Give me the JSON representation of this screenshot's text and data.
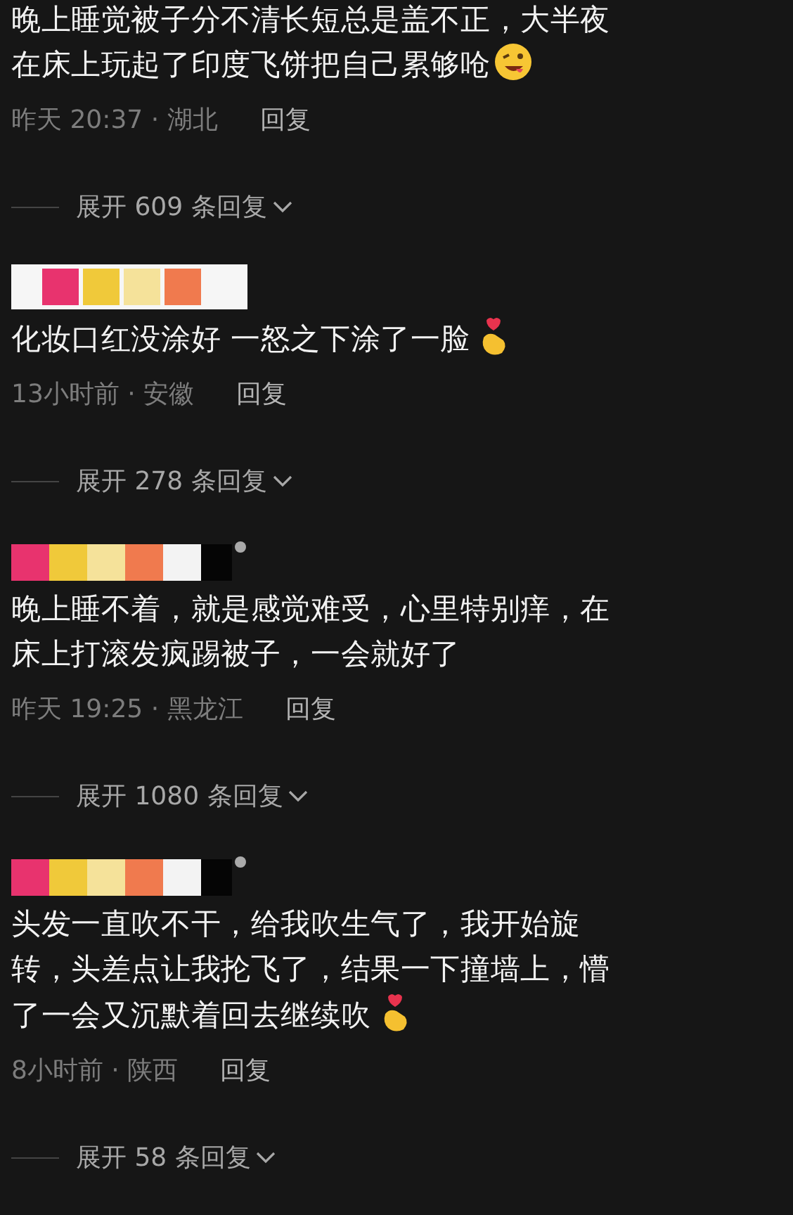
{
  "comments": [
    {
      "lines": [
        "晚上睡觉被子分不清长短总是盖不正，大半夜",
        "在床上玩起了印度飞饼把自己累够呛"
      ],
      "emoji": {
        "kind": "wink"
      },
      "meta": "昨天 20:37 · 湖北",
      "reply": "回复",
      "expand": "展开 609 条回复"
    },
    {
      "name": {
        "kind": "framed"
      },
      "lines": [
        "化妆口红没涂好 一怒之下涂了一脸"
      ],
      "emoji": {
        "kind": "hand"
      },
      "meta": "13小时前 · 安徽",
      "reply": "回复",
      "expand": "展开 278 条回复"
    },
    {
      "name": {
        "kind": "dot"
      },
      "lines": [
        "晚上睡不着，就是感觉难受，心里特别痒，在",
        "床上打滚发疯踢被子，一会就好了"
      ],
      "meta": "昨天 19:25 · 黑龙江",
      "reply": "回复",
      "expand": "展开 1080 条回复"
    },
    {
      "name": {
        "kind": "dot"
      },
      "lines": [
        "头发一直吹不干，给我吹生气了，我开始旋",
        "转，头差点让我抡飞了，结果一下撞墙上，懵",
        "了一会又沉默着回去继续吹"
      ],
      "emoji": {
        "kind": "hand"
      },
      "meta": "8小时前 · 陕西",
      "reply": "回复",
      "expand": "展开 58 条回复"
    }
  ]
}
